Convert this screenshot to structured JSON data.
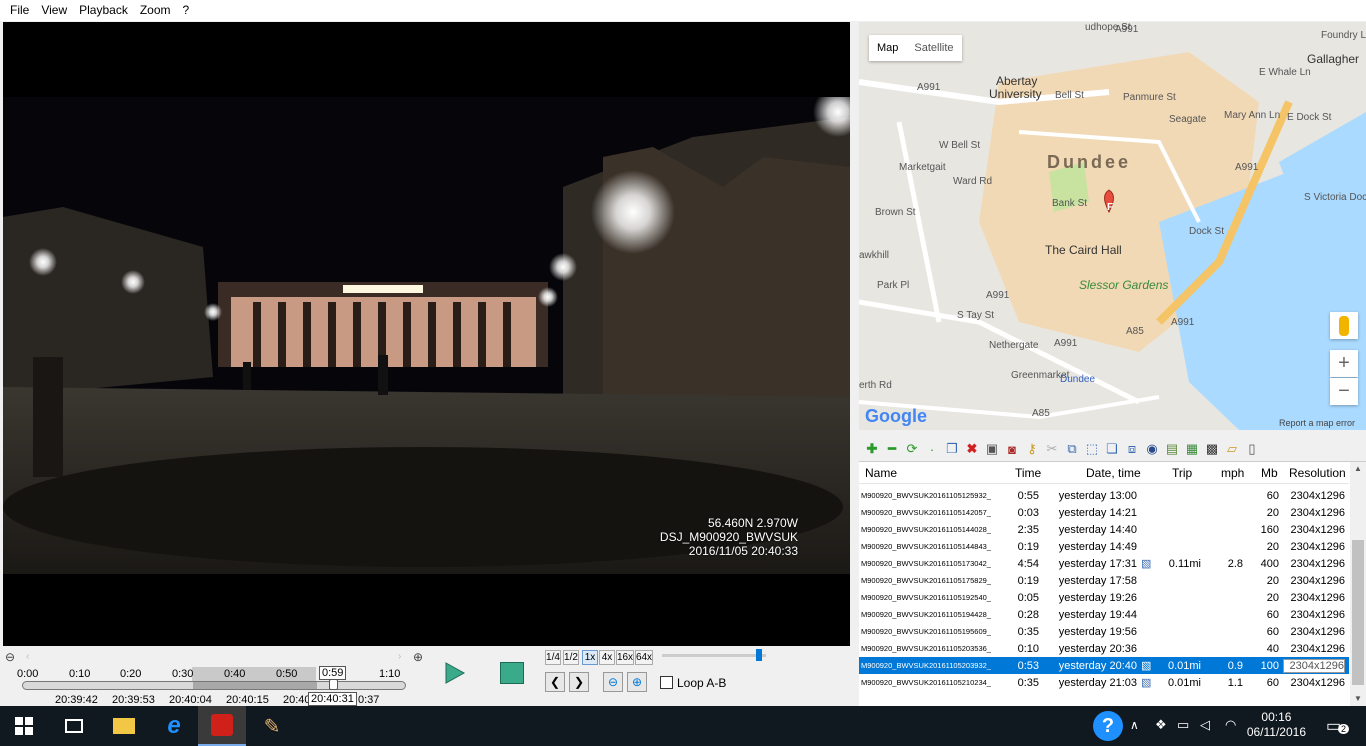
{
  "menu": [
    "File",
    "View",
    "Playback",
    "Zoom",
    "?"
  ],
  "overlay": {
    "coords": "56.460N   2.970W",
    "camera_id": "DSJ_M900920_BWVSUK",
    "datetime": "2016/11/05 20:40:33"
  },
  "timeline": {
    "ticks": [
      "0:00",
      "0:10",
      "0:20",
      "0:30",
      "0:40",
      "0:50",
      "0:59",
      "1:10"
    ],
    "clocks": [
      "20:39:42",
      "20:39:53",
      "20:40:04",
      "20:40:15",
      "20:40",
      "20:40:31",
      "0:37"
    ]
  },
  "speeds": [
    "1/4",
    "1/2",
    "1x",
    "4x",
    "16x",
    "64x"
  ],
  "loop_label": "Loop A-B",
  "map": {
    "tabs": [
      "Map",
      "Satellite"
    ],
    "labels": {
      "abertay": "Abertay",
      "university": "University",
      "city": "Dundee",
      "caird": "The Caird Hall",
      "slessor": "Slessor Gardens",
      "dundee_station": "Dundee",
      "gallagher": "Gallagher",
      "foundry": "Foundry L",
      "wbell": "W Bell St",
      "bell": "Bell St",
      "ward": "Ward Rd",
      "bank": "Bank St",
      "panmure": "Panmure St",
      "dock": "Dock St",
      "edock": "E Dock St",
      "svictoria": "S Victoria Dock",
      "marketgait": "Marketgait",
      "brown": "Brown St",
      "hawkhill": "awkhill",
      "park": "Park Pl",
      "staay": "S Tay St",
      "nethergate": "Nethergate",
      "greenmarket": "Greenmarket",
      "perth": "erth Rd",
      "seagate": "Seagate",
      "maryann": "Mary Ann Ln",
      "ewhale": "E Whale Ln",
      "a991": "A991",
      "a85": "A85",
      "google": "Google",
      "report": "Report a map error",
      "marker": "F",
      "dudhope": "udhope St"
    },
    "zoom_in": "+",
    "zoom_out": "−"
  },
  "list": {
    "headers": {
      "name": "Name",
      "time": "Time",
      "date": "Date, time",
      "trip": "Trip",
      "mph": "mph",
      "mb": "Mb",
      "res": "Resolution"
    },
    "rows": [
      {
        "name": "M900920_BWVSUK20161105125932_...",
        "time": "0:55",
        "date": "yesterday 13:00",
        "trip": "",
        "mph": "",
        "mb": "60",
        "res": "2304x1296"
      },
      {
        "name": "M900920_BWVSUK20161105142057_...",
        "time": "0:03",
        "date": "yesterday 14:21",
        "trip": "",
        "mph": "",
        "mb": "20",
        "res": "2304x1296"
      },
      {
        "name": "M900920_BWVSUK20161105144028_...",
        "time": "2:35",
        "date": "yesterday 14:40",
        "trip": "",
        "mph": "",
        "mb": "160",
        "res": "2304x1296"
      },
      {
        "name": "M900920_BWVSUK20161105144843_...",
        "time": "0:19",
        "date": "yesterday 14:49",
        "trip": "",
        "mph": "",
        "mb": "20",
        "res": "2304x1296"
      },
      {
        "name": "M900920_BWVSUK20161105173042_...",
        "time": "4:54",
        "date": "yesterday 17:31",
        "trip": "0.11mi",
        "mph": "2.8",
        "mb": "400",
        "res": "2304x1296"
      },
      {
        "name": "M900920_BWVSUK20161105175829_...",
        "time": "0:19",
        "date": "yesterday 17:58",
        "trip": "",
        "mph": "",
        "mb": "20",
        "res": "2304x1296"
      },
      {
        "name": "M900920_BWVSUK20161105192540_...",
        "time": "0:05",
        "date": "yesterday 19:26",
        "trip": "",
        "mph": "",
        "mb": "20",
        "res": "2304x1296"
      },
      {
        "name": "M900920_BWVSUK20161105194428_...",
        "time": "0:28",
        "date": "yesterday 19:44",
        "trip": "",
        "mph": "",
        "mb": "60",
        "res": "2304x1296"
      },
      {
        "name": "M900920_BWVSUK20161105195609_...",
        "time": "0:35",
        "date": "yesterday 19:56",
        "trip": "",
        "mph": "",
        "mb": "60",
        "res": "2304x1296"
      },
      {
        "name": "M900920_BWVSUK20161105203536_...",
        "time": "0:10",
        "date": "yesterday 20:36",
        "trip": "",
        "mph": "",
        "mb": "40",
        "res": "2304x1296"
      },
      {
        "name": "M900920_BWVSUK20161105203932_...",
        "time": "0:53",
        "date": "yesterday 20:40",
        "trip": "0.01mi",
        "mph": "0.9",
        "mb": "100",
        "res": "2304x1296"
      },
      {
        "name": "M900920_BWVSUK20161105210234_...",
        "time": "0:35",
        "date": "yesterday 21:03",
        "trip": "0.01mi",
        "mph": "1.1",
        "mb": "60",
        "res": "2304x1296"
      }
    ]
  },
  "tray": {
    "time": "00:16",
    "date": "06/11/2016",
    "notifications": "2",
    "help": "?"
  }
}
